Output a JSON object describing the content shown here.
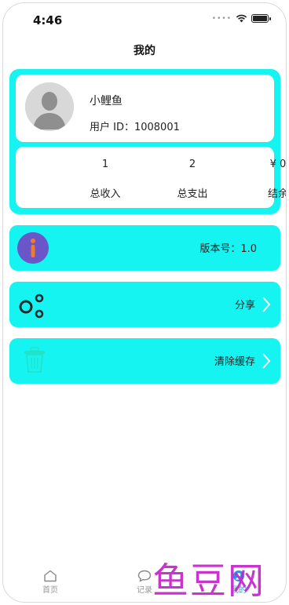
{
  "status_bar": {
    "time": "4:46"
  },
  "nav": {
    "title": "我的"
  },
  "profile": {
    "name": "小鲤鱼",
    "user_id": "用户 ID：1008001",
    "stats": [
      {
        "value": "1",
        "label": "总收入"
      },
      {
        "value": "2",
        "label": "总支出"
      },
      {
        "value": "¥ 0",
        "label": "结余"
      }
    ]
  },
  "menu": [
    {
      "label": "版本号：1.0",
      "icon": "info-icon",
      "arrow": false
    },
    {
      "label": "分享",
      "icon": "share-icon",
      "arrow": true
    },
    {
      "label": "清除缓存",
      "icon": "trash-icon",
      "arrow": true
    }
  ],
  "tabbar": {
    "tabs": [
      {
        "label": "首页",
        "icon": "home-icon"
      },
      {
        "label": "记录",
        "icon": "chat-icon"
      },
      {
        "label": "我的",
        "icon": "profile-icon",
        "active": true
      }
    ]
  },
  "watermark": "鱼豆网",
  "colors": {
    "accent": "#16f4f2",
    "tab_active": "#2196f3",
    "info_icon": "#6a55c9",
    "watermark": "#c424c8"
  }
}
